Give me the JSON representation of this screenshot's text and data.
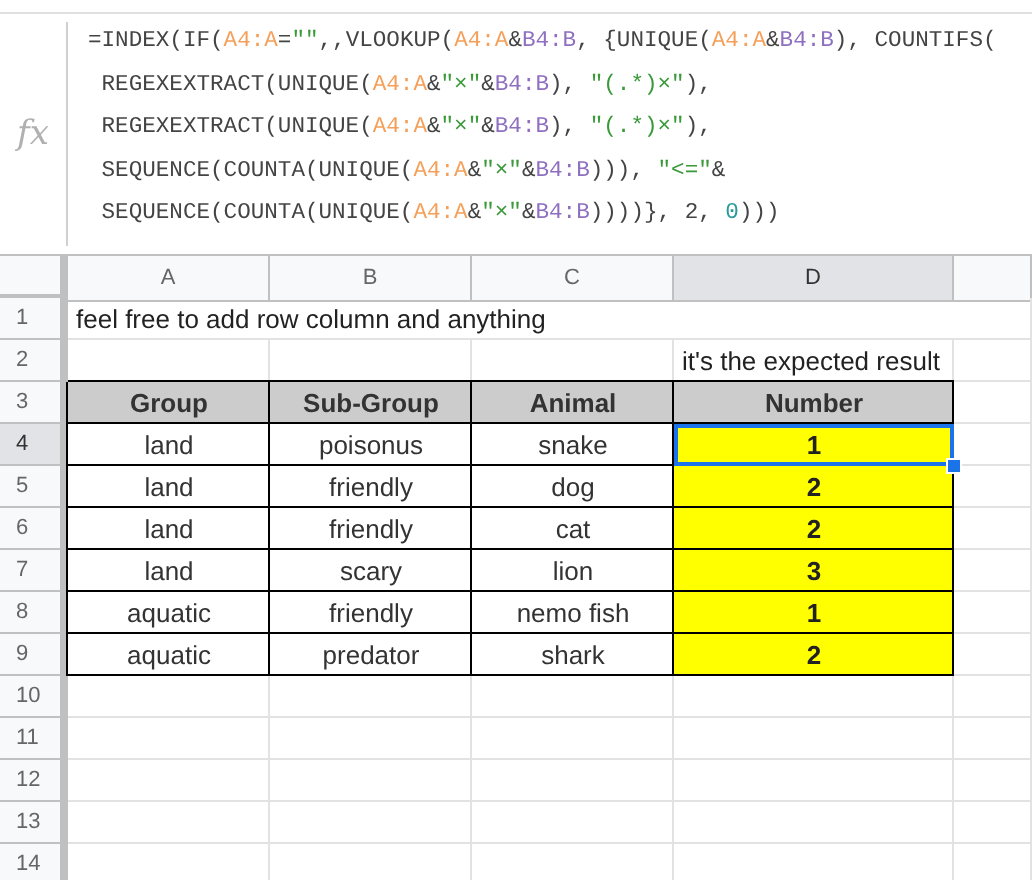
{
  "formula_bar": {
    "icon_label": "fx",
    "lines": [
      [
        {
          "text": "=INDEX(IF(",
          "kind": "plain"
        },
        {
          "text": "A4:A",
          "kind": "ref_a"
        },
        {
          "text": "=",
          "kind": "plain"
        },
        {
          "text": "\"\"",
          "kind": "string"
        },
        {
          "text": ",,VLOOKUP(",
          "kind": "plain"
        },
        {
          "text": "A4:A",
          "kind": "ref_a"
        },
        {
          "text": "&",
          "kind": "plain"
        },
        {
          "text": "B4:B",
          "kind": "ref_b"
        },
        {
          "text": ", {UNIQUE(",
          "kind": "plain"
        },
        {
          "text": "A4:A",
          "kind": "ref_a"
        },
        {
          "text": "&",
          "kind": "plain"
        },
        {
          "text": "B4:B",
          "kind": "ref_b"
        },
        {
          "text": "), COUNTIFS(",
          "kind": "plain"
        }
      ],
      [
        {
          "text": " REGEXEXTRACT(UNIQUE(",
          "kind": "plain"
        },
        {
          "text": "A4:A",
          "kind": "ref_a"
        },
        {
          "text": "&",
          "kind": "plain"
        },
        {
          "text": "\"×\"",
          "kind": "string"
        },
        {
          "text": "&",
          "kind": "plain"
        },
        {
          "text": "B4:B",
          "kind": "ref_b"
        },
        {
          "text": "), ",
          "kind": "plain"
        },
        {
          "text": "\"(.*)×\"",
          "kind": "string"
        },
        {
          "text": "),",
          "kind": "plain"
        }
      ],
      [
        {
          "text": " REGEXEXTRACT(UNIQUE(",
          "kind": "plain"
        },
        {
          "text": "A4:A",
          "kind": "ref_a"
        },
        {
          "text": "&",
          "kind": "plain"
        },
        {
          "text": "\"×\"",
          "kind": "string"
        },
        {
          "text": "&",
          "kind": "plain"
        },
        {
          "text": "B4:B",
          "kind": "ref_b"
        },
        {
          "text": "), ",
          "kind": "plain"
        },
        {
          "text": "\"(.*)×\"",
          "kind": "string"
        },
        {
          "text": "),",
          "kind": "plain"
        }
      ],
      [
        {
          "text": " SEQUENCE(COUNTA(UNIQUE(",
          "kind": "plain"
        },
        {
          "text": "A4:A",
          "kind": "ref_a"
        },
        {
          "text": "&",
          "kind": "plain"
        },
        {
          "text": "\"×\"",
          "kind": "string"
        },
        {
          "text": "&",
          "kind": "plain"
        },
        {
          "text": "B4:B",
          "kind": "ref_b"
        },
        {
          "text": "))), ",
          "kind": "plain"
        },
        {
          "text": "\"<=\"",
          "kind": "string"
        },
        {
          "text": "&",
          "kind": "plain"
        }
      ],
      [
        {
          "text": " SEQUENCE(COUNTA(UNIQUE(",
          "kind": "plain"
        },
        {
          "text": "A4:A",
          "kind": "ref_a"
        },
        {
          "text": "&",
          "kind": "plain"
        },
        {
          "text": "\"×\"",
          "kind": "string"
        },
        {
          "text": "&",
          "kind": "plain"
        },
        {
          "text": "B4:B",
          "kind": "ref_b"
        },
        {
          "text": "))))}, 2, ",
          "kind": "plain"
        },
        {
          "text": "0",
          "kind": "number"
        },
        {
          "text": ")))",
          "kind": "plain"
        }
      ]
    ]
  },
  "columns": [
    {
      "label": "A",
      "selected": false
    },
    {
      "label": "B",
      "selected": false
    },
    {
      "label": "C",
      "selected": false
    },
    {
      "label": "D",
      "selected": true
    }
  ],
  "rows": [
    {
      "number": "1",
      "selected": false,
      "cells": [
        {
          "text": "feel free to add row column and anything",
          "kind": "note"
        }
      ]
    },
    {
      "number": "2",
      "selected": false,
      "cells": [
        null,
        null,
        null,
        {
          "text": "it's the expected result",
          "kind": "note"
        }
      ]
    },
    {
      "number": "3",
      "selected": false,
      "cells": [
        {
          "text": "Group",
          "kind": "header"
        },
        {
          "text": "Sub-Group",
          "kind": "header"
        },
        {
          "text": "Animal",
          "kind": "header"
        },
        {
          "text": "Number",
          "kind": "header"
        }
      ]
    },
    {
      "number": "4",
      "selected": true,
      "cells": [
        {
          "text": "land",
          "kind": "data"
        },
        {
          "text": "poisonus",
          "kind": "data"
        },
        {
          "text": "snake",
          "kind": "data"
        },
        {
          "text": "1",
          "kind": "result",
          "selected": true
        }
      ]
    },
    {
      "number": "5",
      "selected": false,
      "cells": [
        {
          "text": "land",
          "kind": "data"
        },
        {
          "text": "friendly",
          "kind": "data"
        },
        {
          "text": "dog",
          "kind": "data"
        },
        {
          "text": "2",
          "kind": "result",
          "selected": false
        }
      ]
    },
    {
      "number": "6",
      "selected": false,
      "cells": [
        {
          "text": "land",
          "kind": "data"
        },
        {
          "text": "friendly",
          "kind": "data"
        },
        {
          "text": "cat",
          "kind": "data"
        },
        {
          "text": "2",
          "kind": "result",
          "selected": false
        }
      ]
    },
    {
      "number": "7",
      "selected": false,
      "cells": [
        {
          "text": "land",
          "kind": "data"
        },
        {
          "text": "scary",
          "kind": "data"
        },
        {
          "text": "lion",
          "kind": "data"
        },
        {
          "text": "3",
          "kind": "result",
          "selected": false
        }
      ]
    },
    {
      "number": "8",
      "selected": false,
      "cells": [
        {
          "text": "aquatic",
          "kind": "data"
        },
        {
          "text": "friendly",
          "kind": "data"
        },
        {
          "text": "nemo fish",
          "kind": "data"
        },
        {
          "text": "1",
          "kind": "result",
          "selected": false
        }
      ]
    },
    {
      "number": "9",
      "selected": false,
      "cells": [
        {
          "text": "aquatic",
          "kind": "data"
        },
        {
          "text": "predator",
          "kind": "data"
        },
        {
          "text": "shark",
          "kind": "data"
        },
        {
          "text": "2",
          "kind": "result",
          "selected": false
        }
      ]
    },
    {
      "number": "10",
      "selected": false
    },
    {
      "number": "11",
      "selected": false
    },
    {
      "number": "12",
      "selected": false
    },
    {
      "number": "13",
      "selected": false
    },
    {
      "number": "14",
      "selected": false
    }
  ]
}
